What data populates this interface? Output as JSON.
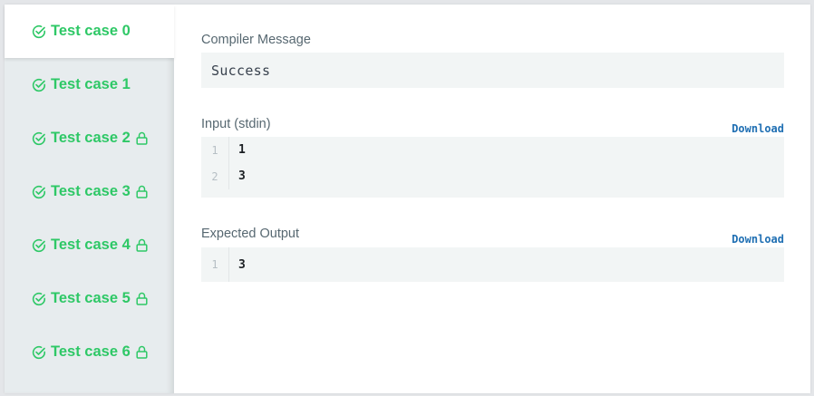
{
  "tabs": [
    {
      "label": "Test case 0",
      "locked": false,
      "active": true
    },
    {
      "label": "Test case 1",
      "locked": false,
      "active": false
    },
    {
      "label": "Test case 2",
      "locked": true,
      "active": false
    },
    {
      "label": "Test case 3",
      "locked": true,
      "active": false
    },
    {
      "label": "Test case 4",
      "locked": true,
      "active": false
    },
    {
      "label": "Test case 5",
      "locked": true,
      "active": false
    },
    {
      "label": "Test case 6",
      "locked": true,
      "active": false
    }
  ],
  "compiler": {
    "label": "Compiler Message",
    "message": "Success"
  },
  "input": {
    "label": "Input (stdin)",
    "download_label": "Download",
    "lines": [
      {
        "number": "1",
        "text": "1"
      },
      {
        "number": "2",
        "text": "3"
      }
    ]
  },
  "expected": {
    "label": "Expected Output",
    "download_label": "Download",
    "lines": [
      {
        "number": "1",
        "text": "3"
      }
    ]
  },
  "colors": {
    "success_green": "#2ec866",
    "link_blue": "#1f6fb3",
    "sidebar_bg": "#e7ecee",
    "code_bg": "#f2f5f5"
  },
  "icons": {
    "tab_status": "check-circle-icon",
    "tab_locked": "lock-icon"
  }
}
